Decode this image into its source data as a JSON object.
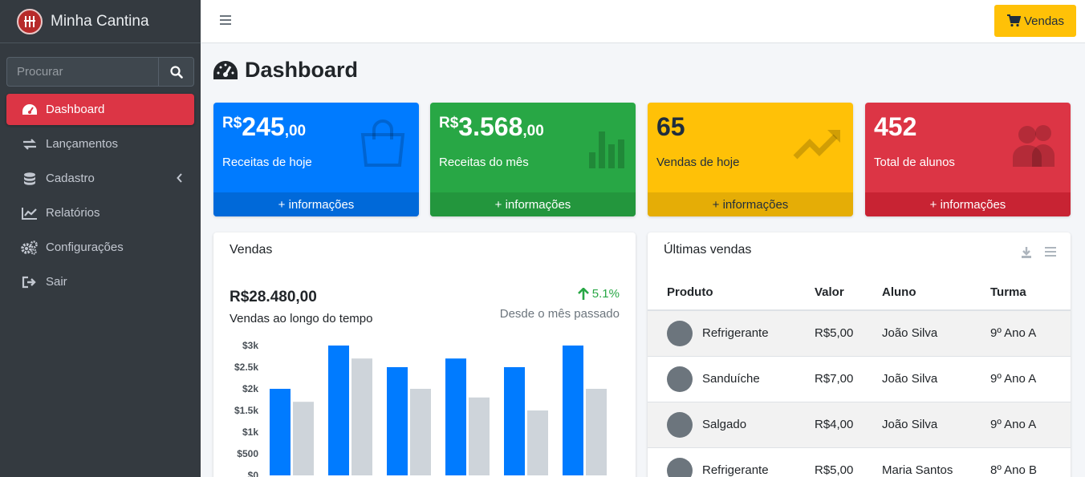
{
  "brand": {
    "title": "Minha Cantina"
  },
  "sidebar": {
    "search_placeholder": "Procurar",
    "items": [
      {
        "label": "Dashboard",
        "icon": "tachometer-icon",
        "active": true
      },
      {
        "label": "Lançamentos",
        "icon": "exchange-icon"
      },
      {
        "label": "Cadastro",
        "icon": "database-icon"
      },
      {
        "label": "Relatórios",
        "icon": "area-chart-icon"
      },
      {
        "label": "Configurações",
        "icon": "cogs-icon"
      },
      {
        "label": "Sair",
        "icon": "sign-out-icon"
      }
    ]
  },
  "topbar": {
    "vendas_label": "Vendas"
  },
  "page": {
    "title": "Dashboard"
  },
  "boxes": [
    {
      "currency": "R$",
      "integer": "245",
      "decimal": ",00",
      "label": "Receitas de hoje",
      "footer": "+ informações",
      "color": "#007bff",
      "icon": "shopping-bag-icon"
    },
    {
      "currency": "R$",
      "integer": "3.568",
      "decimal": ",00",
      "label": "Receitas do mês",
      "footer": "+ informações",
      "color": "#28a745",
      "icon": "bar-chart-icon"
    },
    {
      "value": "65",
      "label": "Vendas de hoje",
      "footer": "+ informações",
      "color": "#ffc107",
      "icon": "trending-up-icon"
    },
    {
      "value": "452",
      "label": "Total de alunos",
      "footer": "+ informações",
      "color": "#dc3545",
      "icon": "users-icon"
    }
  ],
  "sales_card": {
    "title": "Vendas",
    "total": "R$28.480,00",
    "total_label": "Vendas ao longo do tempo",
    "change": "5.1%",
    "change_label": "Desde o mês passado"
  },
  "chart_data": {
    "type": "bar",
    "categories": [
      "",
      "",
      "",
      "",
      "",
      ""
    ],
    "series": [
      {
        "values": [
          2000,
          3000,
          2500,
          2700,
          2500,
          3000
        ],
        "color": "#007bff"
      },
      {
        "values": [
          1700,
          2700,
          2000,
          1800,
          1500,
          2000
        ],
        "color": "#ced4da"
      }
    ],
    "ylim": [
      0,
      3000
    ],
    "yticks": [
      "$3k",
      "$2.5k",
      "$2k",
      "$1.5k",
      "$1k",
      "$500",
      "$0"
    ],
    "grid": false
  },
  "last_sales": {
    "title": "Últimas vendas",
    "columns": [
      "Produto",
      "Valor",
      "Aluno",
      "Turma"
    ],
    "rows": [
      {
        "produto": "Refrigerante",
        "valor": "R$5,00",
        "aluno": "João Silva",
        "turma": "9º Ano A"
      },
      {
        "produto": "Sanduíche",
        "valor": "R$7,00",
        "aluno": "João Silva",
        "turma": "9º Ano A"
      },
      {
        "produto": "Salgado",
        "valor": "R$4,00",
        "aluno": "João Silva",
        "turma": "9º Ano A"
      },
      {
        "produto": "Refrigerante",
        "valor": "R$5,00",
        "aluno": "Maria Santos",
        "turma": "8º Ano B"
      }
    ]
  }
}
